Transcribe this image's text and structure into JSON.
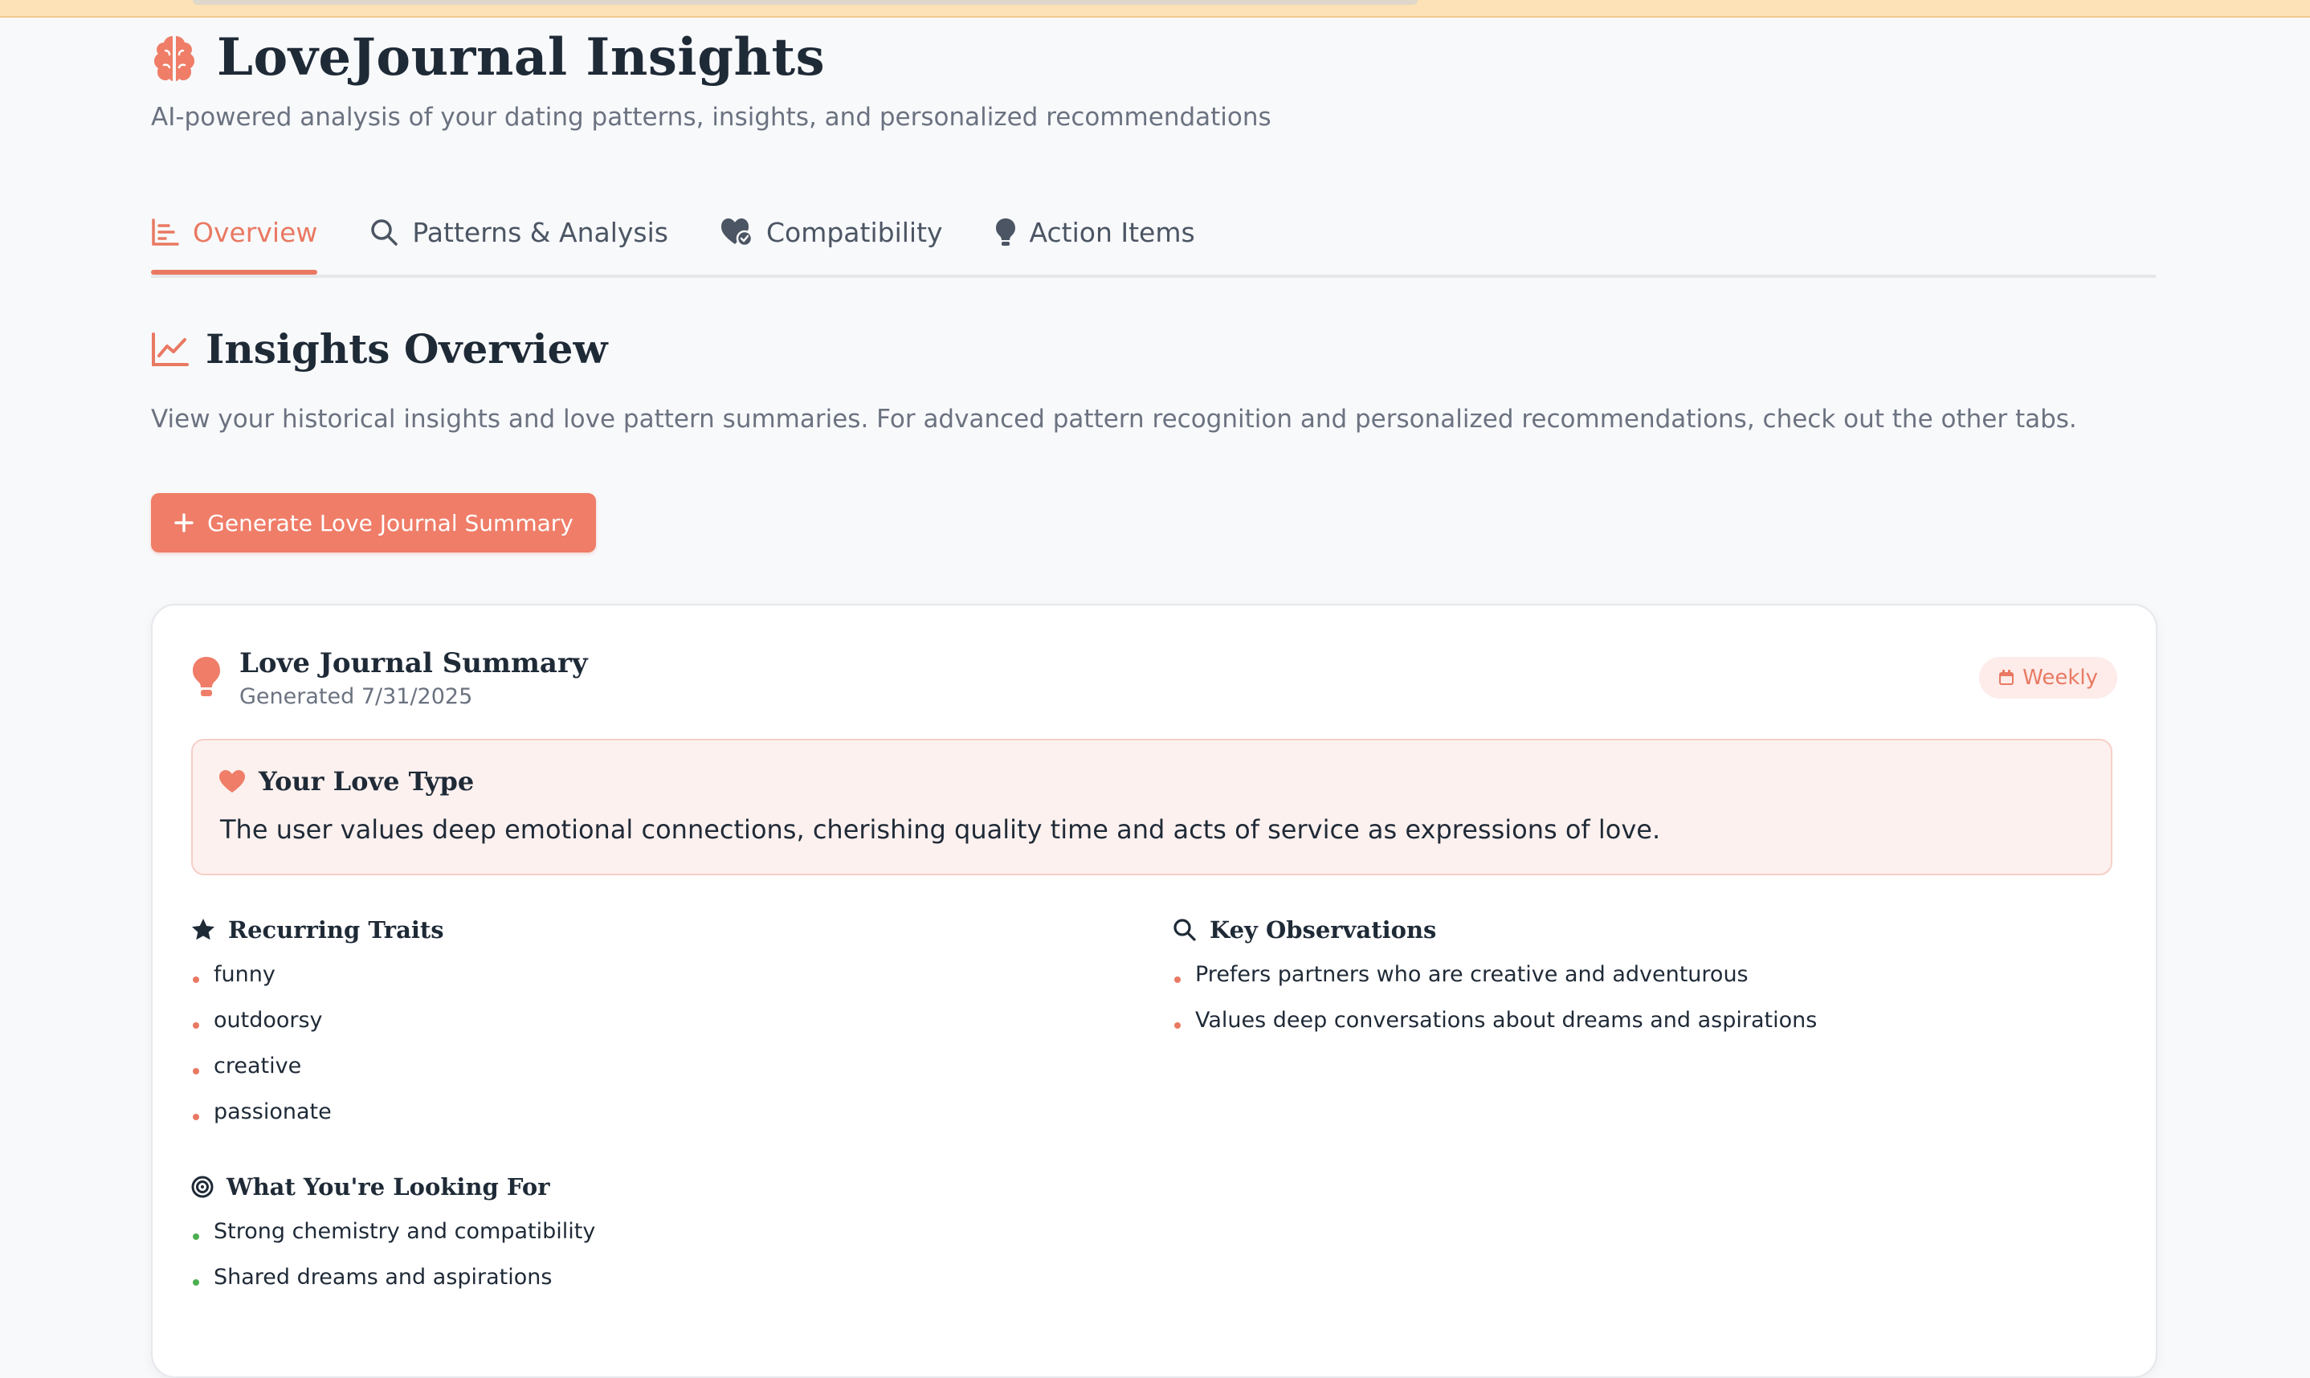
{
  "app": {
    "title": "LoveJournal Insights",
    "subtitle": "AI-powered analysis of your dating patterns, insights, and personalized recommendations"
  },
  "tabs": [
    {
      "label": "Overview",
      "icon": "bar-chart-icon",
      "active": true
    },
    {
      "label": "Patterns & Analysis",
      "icon": "search-icon",
      "active": false
    },
    {
      "label": "Compatibility",
      "icon": "heart-check-icon",
      "active": false
    },
    {
      "label": "Action Items",
      "icon": "lightbulb-icon",
      "active": false
    }
  ],
  "overview": {
    "title": "Insights Overview",
    "description": "View your historical insights and love pattern summaries. For advanced pattern recognition and personalized recommendations, check out the other tabs.",
    "generate_button": "Generate Love Journal Summary"
  },
  "summary_card": {
    "title": "Love Journal Summary",
    "generated": "Generated 7/31/2025",
    "badge": "Weekly",
    "love_type": {
      "heading": "Your Love Type",
      "text": "The user values deep emotional connections, cherishing quality time and acts of service as expressions of love."
    },
    "recurring_traits": {
      "heading": "Recurring Traits",
      "items": [
        "funny",
        "outdoorsy",
        "creative",
        "passionate"
      ]
    },
    "key_observations": {
      "heading": "Key Observations",
      "items": [
        "Prefers partners who are creative and adventurous",
        "Values deep conversations about dreams and aspirations"
      ]
    },
    "looking_for": {
      "heading": "What You're Looking For",
      "items": [
        "Strong chemistry and compatibility",
        "Shared dreams and aspirations"
      ]
    }
  },
  "colors": {
    "accent": "#e97962",
    "button": "#ef7d68",
    "love_type_bg": "#fdf1ef",
    "green_bullet": "#4caf50"
  }
}
